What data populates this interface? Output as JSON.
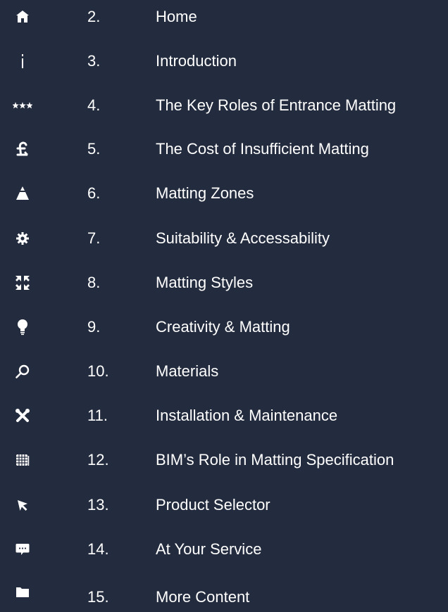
{
  "colors": {
    "background": "#232b3e",
    "text": "#ffffff"
  },
  "toc": {
    "items": [
      {
        "icon": "home-icon",
        "number": "2.",
        "label": "Home"
      },
      {
        "icon": "info-icon",
        "number": "3.",
        "label": "Introduction"
      },
      {
        "icon": "stars-icon",
        "number": "4.",
        "label": "The Key Roles of Entrance Matting"
      },
      {
        "icon": "pound-icon",
        "number": "5.",
        "label": "The Cost of Insufficient Matting"
      },
      {
        "icon": "zones-icon",
        "number": "6.",
        "label": "Matting Zones"
      },
      {
        "icon": "gear-icon",
        "number": "7.",
        "label": "Suitability & Accessability"
      },
      {
        "icon": "styles-icon",
        "number": "8.",
        "label": "Matting Styles"
      },
      {
        "icon": "lightbulb-icon",
        "number": "9.",
        "label": "Creativity & Matting"
      },
      {
        "icon": "search-icon",
        "number": "10.",
        "label": "Materials"
      },
      {
        "icon": "tools-icon",
        "number": "11.",
        "label": "Installation & Maintenance"
      },
      {
        "icon": "grid-icon",
        "number": "12.",
        "label": "BIM’s Role in Matting Specification"
      },
      {
        "icon": "cursor-icon",
        "number": "13.",
        "label": "Product Selector"
      },
      {
        "icon": "chat-icon",
        "number": "14.",
        "label": "At Your Service"
      },
      {
        "icon": "folder-icon",
        "number": "15.",
        "label": "More Content"
      }
    ]
  }
}
